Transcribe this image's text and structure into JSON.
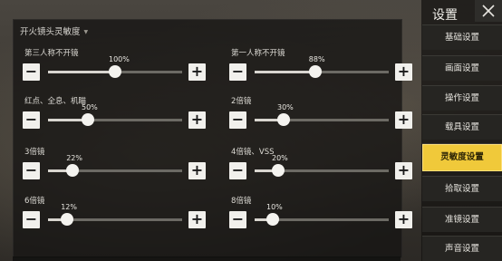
{
  "panel": {
    "title": "开火镜头灵敏度"
  },
  "sliders": [
    {
      "label": "第三人称不开镜",
      "value": 100,
      "value_text": "100%"
    },
    {
      "label": "第一人称不开镜",
      "value": 88,
      "value_text": "88%"
    },
    {
      "label": "红点、全息、机瞄",
      "value": 50,
      "value_text": "50%"
    },
    {
      "label": "2倍镜",
      "value": 30,
      "value_text": "30%"
    },
    {
      "label": "3倍镜",
      "value": 22,
      "value_text": "22%"
    },
    {
      "label": "4倍镜、VSS",
      "value": 20,
      "value_text": "20%"
    },
    {
      "label": "6倍镜",
      "value": 12,
      "value_text": "12%"
    },
    {
      "label": "8倍镜",
      "value": 10,
      "value_text": "10%"
    }
  ],
  "sidebar": {
    "title": "设置",
    "close_icon": "close-icon",
    "items": [
      {
        "label": "基础设置"
      },
      {
        "label": "画面设置"
      },
      {
        "label": "操作设置"
      },
      {
        "label": "载具设置"
      },
      {
        "label": "灵敏度设置",
        "active": true
      },
      {
        "label": "拾取设置"
      },
      {
        "label": "准镜设置"
      },
      {
        "label": "声音设置"
      }
    ]
  },
  "colors": {
    "accent": "#f0c93a"
  },
  "slider_range": {
    "min": 0,
    "max": 100
  }
}
